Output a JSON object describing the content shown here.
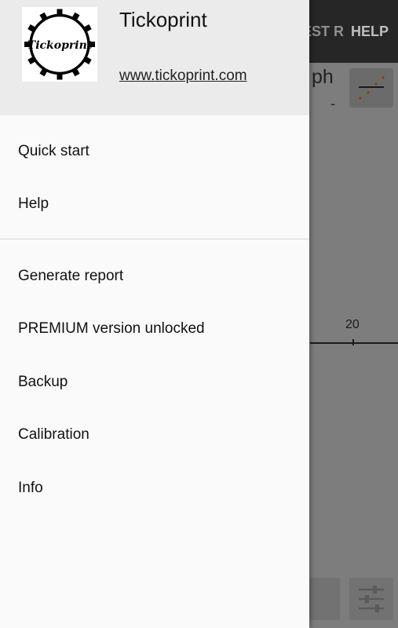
{
  "background": {
    "toolbar_actions": [
      "EST R",
      "HELP"
    ],
    "unit_label": "ph",
    "unit_value": "-",
    "axis_tick_label": "20"
  },
  "drawer": {
    "header": {
      "logo_text": "Tickoprint",
      "app_name": "Tickoprint",
      "website": "www.tickoprint.com"
    },
    "menu_primary": [
      {
        "label": "Quick start"
      },
      {
        "label": "Help"
      }
    ],
    "menu_secondary": [
      {
        "label": "Generate report"
      },
      {
        "label": "PREMIUM version unlocked"
      },
      {
        "label": "Backup"
      },
      {
        "label": "Calibration"
      },
      {
        "label": "Info"
      }
    ]
  },
  "colors": {
    "scrim": "#7d7d7d",
    "toolbar": "#262626",
    "drawer_bg": "#fafafa",
    "header_bg": "#ebebeb"
  },
  "icons": [
    "tickoprint-logo-icon",
    "graph-icon",
    "sliders-icon"
  ]
}
